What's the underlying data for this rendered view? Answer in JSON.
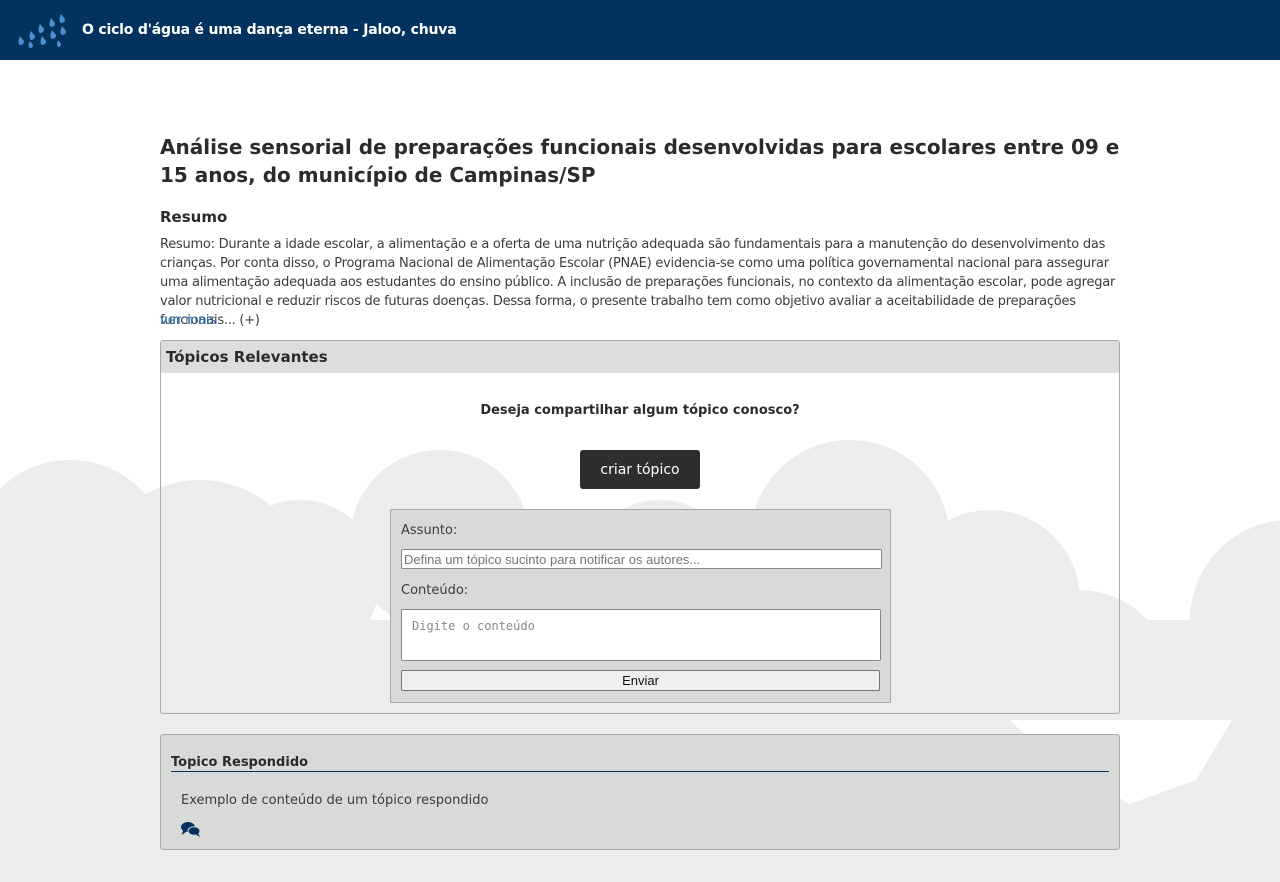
{
  "header": {
    "site_title": "O ciclo d'água é uma dança eterna - Jaloo, chuva",
    "logo_icon": "rain-drops-icon",
    "background_color": "#04325e"
  },
  "article": {
    "title": "Análise sensorial de preparações funcionais desenvolvidas para escolares entre 09 e 15 anos, do município de Campinas/SP",
    "abstract_heading": "Resumo",
    "abstract_text": "Resumo: Durante a idade escolar, a alimentação e a oferta de uma nutrição adequada são fundamentais para a manutenção do desenvolvimento das crianças. Por conta disso, o Programa Nacional de Alimentação Escolar (PNAE) evidencia-se como uma política governamental nacional para assegurar uma alimentação adequada aos estudantes do ensino público. A inclusão de preparações funcionais, no contexto da alimentação escolar, pode agregar valor nutricional e reduzir riscos de futuras doenças. Dessa forma, o presente trabalho tem como objetivo avaliar a aceitabilidade de preparações funcionais... (+)",
    "ver_mais_label": "ver mais",
    "link_color": "#2a7ac0"
  },
  "topics": {
    "panel_title": "Tópicos Relevantes",
    "share_question": "Deseja compartilhar algum tópico conosco?",
    "create_button_label": "criar tópico",
    "form": {
      "subject_label": "Assunto:",
      "subject_placeholder": "Defina um tópico sucinto para notificar os autores...",
      "subject_value": "",
      "content_label": "Conteúdo:",
      "content_placeholder": "Digite o conteúdo",
      "content_value": "",
      "submit_label": "Enviar"
    }
  },
  "answered_topic": {
    "title": "Topico Respondido",
    "content": "Exemplo de conteúdo de um tópico respondido",
    "icon": "comments-icon",
    "icon_color": "#04325e"
  }
}
